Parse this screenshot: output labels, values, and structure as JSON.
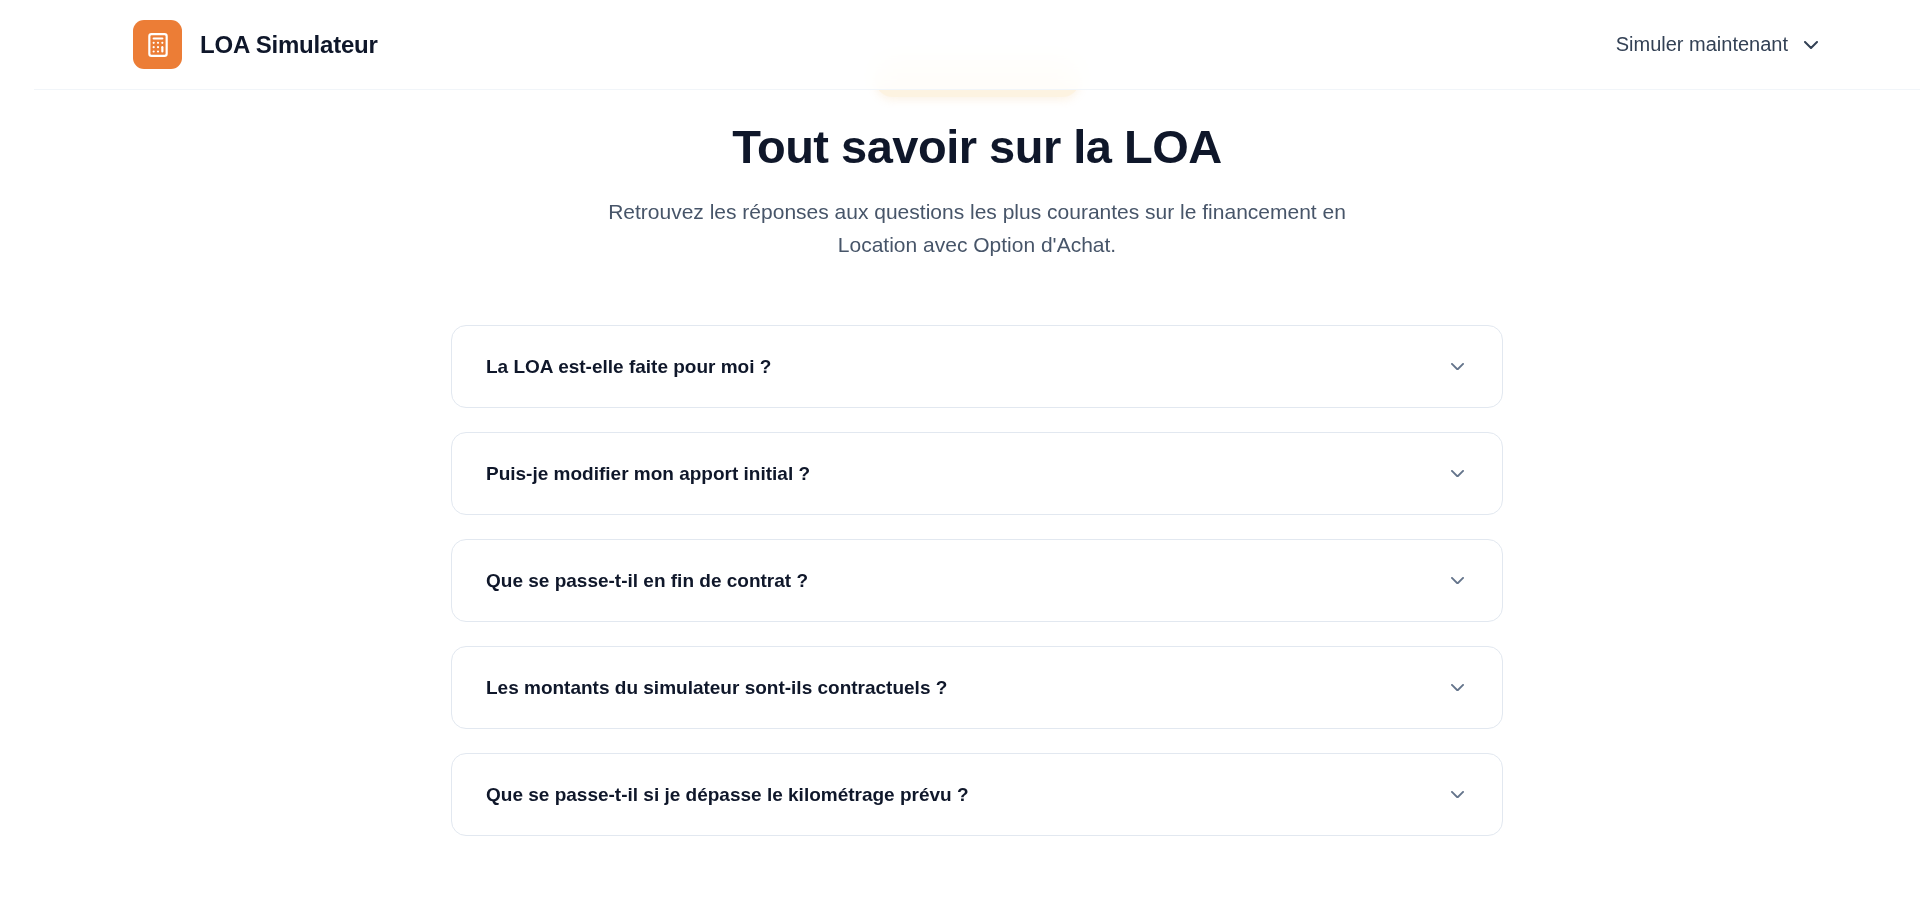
{
  "header": {
    "brand": "LOA Simulateur",
    "action": {
      "label": "Simuler maintenant"
    }
  },
  "hero": {
    "title": "Tout savoir sur la LOA",
    "subtitle": "Retrouvez les réponses aux questions les plus courantes sur le financement en Location avec Option d'Achat."
  },
  "faq": [
    {
      "question": "La LOA est-elle faite pour moi ?",
      "expanded": false
    },
    {
      "question": "Puis-je modifier mon apport initial ?",
      "expanded": false
    },
    {
      "question": "Que se passe-t-il en fin de contrat ?",
      "expanded": false
    },
    {
      "question": "Les montants du simulateur sont-ils contractuels ?",
      "expanded": false
    },
    {
      "question": "Que se passe-t-il si je dépasse le kilométrage prévu ?",
      "expanded": false
    }
  ]
}
